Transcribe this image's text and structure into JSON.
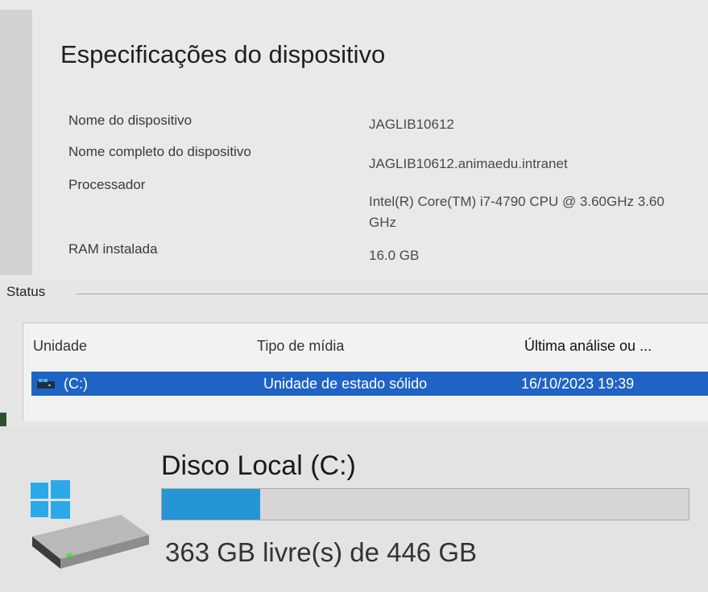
{
  "specs": {
    "title": "Especificações do dispositivo",
    "rows": [
      {
        "label": "Nome do dispositivo",
        "value": "JAGLIB10612"
      },
      {
        "label": "Nome completo do dispositivo",
        "value": "JAGLIB10612.animaedu.intranet"
      },
      {
        "label": "Processador",
        "value": "Intel(R) Core(TM) i7-4790 CPU @ 3.60GHz   3.60 GHz"
      },
      {
        "label": "RAM instalada",
        "value": "16.0 GB"
      }
    ]
  },
  "status": {
    "legend": "Status",
    "columns": [
      "Unidade",
      "Tipo de mídia",
      "Última análise ou ..."
    ],
    "rows": [
      {
        "unit": "(C:)",
        "media_type": "Unidade de estado sólido",
        "last_analysis": "16/10/2023 19:39"
      }
    ]
  },
  "disk": {
    "name": "Disco Local (C:)",
    "free_text": "363 GB livre(s) de 446 GB",
    "used_fraction": 0.186
  },
  "icons": {
    "drive_small": "drive-icon",
    "disk_large": "windows-drive-icon"
  },
  "colors": {
    "selection": "#1f63c4",
    "bar_fill": "#2695d6"
  }
}
